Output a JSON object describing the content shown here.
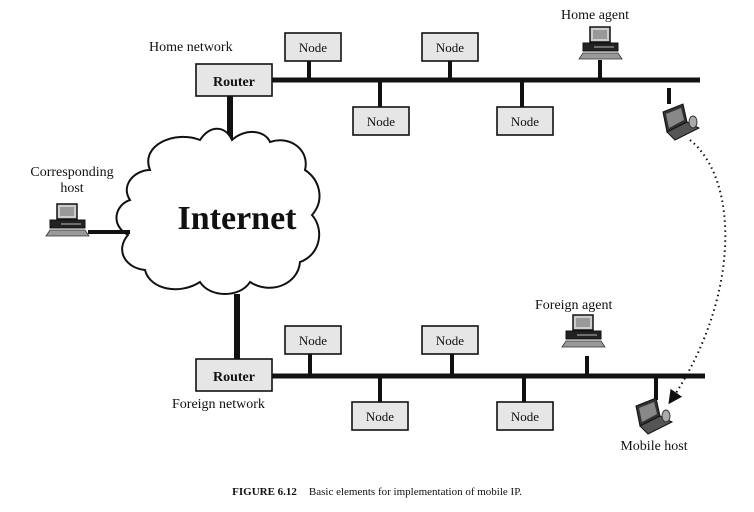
{
  "home_network": {
    "label": "Home network",
    "router": "Router",
    "nodes_top": [
      "Node",
      "Node"
    ],
    "nodes_bottom": [
      "Node",
      "Node"
    ],
    "agent_label": "Home agent"
  },
  "foreign_network": {
    "label": "Foreign network",
    "router": "Router",
    "nodes_top": [
      "Node",
      "Node"
    ],
    "nodes_bottom": [
      "Node",
      "Node"
    ],
    "agent_label": "Foreign agent",
    "mobile_label": "Mobile host"
  },
  "internet_label": "Internet",
  "corresponding_host": {
    "line1": "Corresponding",
    "line2": "host"
  },
  "icons": {
    "desktop": "desktop-computer-icon",
    "laptop": "laptop-icon",
    "cloud": "cloud-icon"
  },
  "caption": {
    "figure": "FIGURE 6.12",
    "text": "Basic elements for implementation of mobile IP."
  }
}
